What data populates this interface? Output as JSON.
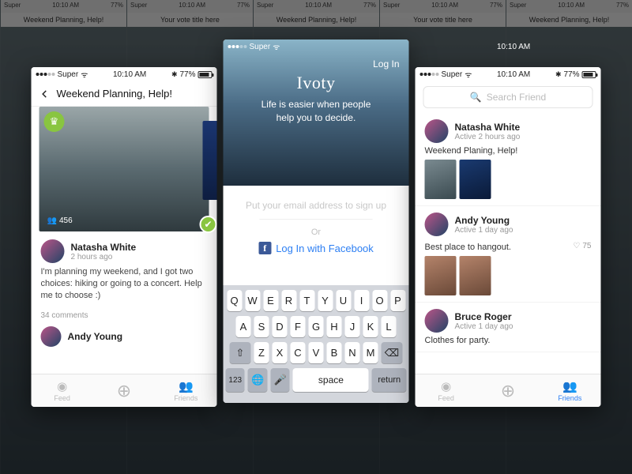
{
  "statusbar": {
    "carrier": "Super",
    "time": "10:10 AM",
    "battery": "77%"
  },
  "left": {
    "title": "Weekend Planning, Help!",
    "count": "456",
    "author": "Natasha White",
    "time": "2 hours ago",
    "body": "I'm planning my weekend, and I got two choices: hiking or going to a concert. Help me to choose :)",
    "comments": "34 comments",
    "commenter": "Andy Young"
  },
  "center": {
    "login": "Log In",
    "app": "Ivoty",
    "tagline1": "Life is easier when people",
    "tagline2": "help you to decide.",
    "email_ph": "Put your email address to sign up",
    "or": "Or",
    "fb": "Log In with Facebook",
    "keys_r1": [
      "Q",
      "W",
      "E",
      "R",
      "T",
      "Y",
      "U",
      "I",
      "O",
      "P"
    ],
    "keys_r2": [
      "A",
      "S",
      "D",
      "F",
      "G",
      "H",
      "J",
      "K",
      "L"
    ],
    "keys_r3": [
      "Z",
      "X",
      "C",
      "V",
      "B",
      "N",
      "M"
    ],
    "key_123": "123",
    "key_space": "space",
    "key_return": "return"
  },
  "right": {
    "search_ph": "Search Friend",
    "f1_name": "Natasha White",
    "f1_time": "Active 2 hours ago",
    "f1_title": "Weekend Planing, Help!",
    "f2_name": "Andy Young",
    "f2_time": "Active 1 day ago",
    "f2_title": "Best place to hangout.",
    "f2_likes": "75",
    "f3_name": "Bruce Roger",
    "f3_time": "Active 1 day ago",
    "f3_title": "Clothes for party."
  },
  "tabs": {
    "feed": "Feed",
    "friends": "Friends"
  }
}
